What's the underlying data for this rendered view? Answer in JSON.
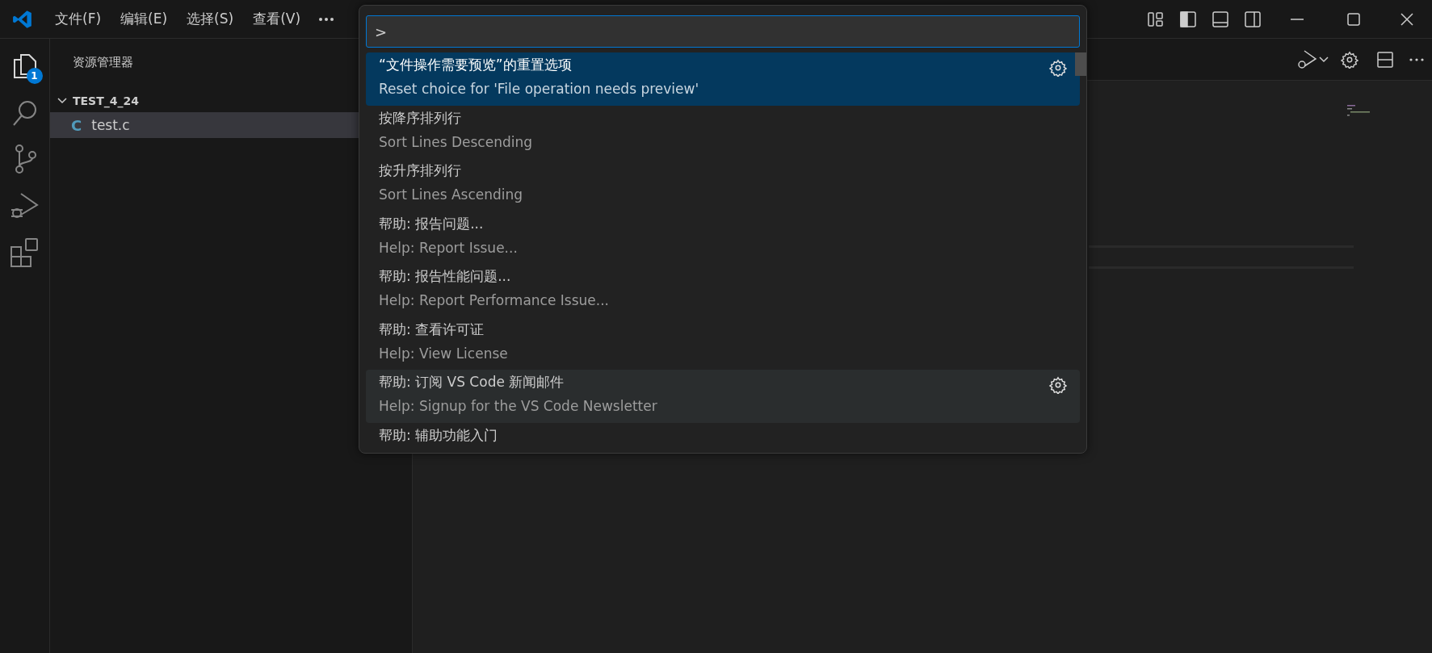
{
  "title_bar": {
    "menus": [
      {
        "label": "文件(F)"
      },
      {
        "label": "编辑(E)"
      },
      {
        "label": "选择(S)"
      },
      {
        "label": "查看(V)"
      }
    ]
  },
  "activity_bar": {
    "explorer_badge": "1"
  },
  "explorer": {
    "title": "资源管理器",
    "folder": {
      "name": "TEST_4_24",
      "expanded": true,
      "children": [
        {
          "name": "test.c",
          "icon": "C",
          "selected": true
        }
      ]
    }
  },
  "command_palette": {
    "input": {
      "value": ">"
    },
    "items": [
      {
        "label": "“文件操作需要预览”的重置选项",
        "detail": "Reset choice for 'File operation needs preview'",
        "selected": true,
        "hovered": false,
        "gear": true
      },
      {
        "label": "按降序排列行",
        "detail": "Sort Lines Descending",
        "selected": false,
        "hovered": false,
        "gear": false
      },
      {
        "label": "按升序排列行",
        "detail": "Sort Lines Ascending",
        "selected": false,
        "hovered": false,
        "gear": false
      },
      {
        "label": "帮助: 报告问题...",
        "detail": "Help: Report Issue...",
        "selected": false,
        "hovered": false,
        "gear": false
      },
      {
        "label": "帮助: 报告性能问题...",
        "detail": "Help: Report Performance Issue...",
        "selected": false,
        "hovered": false,
        "gear": false
      },
      {
        "label": "帮助: 查看许可证",
        "detail": "Help: View License",
        "selected": false,
        "hovered": false,
        "gear": false
      },
      {
        "label": "帮助: 订阅 VS Code 新闻邮件",
        "detail": "Help: Signup for the VS Code Newsletter",
        "selected": false,
        "hovered": true,
        "gear": true
      },
      {
        "label": "帮助: 辅助功能入门",
        "selected": false,
        "hovered": false,
        "gear": false
      }
    ]
  }
}
